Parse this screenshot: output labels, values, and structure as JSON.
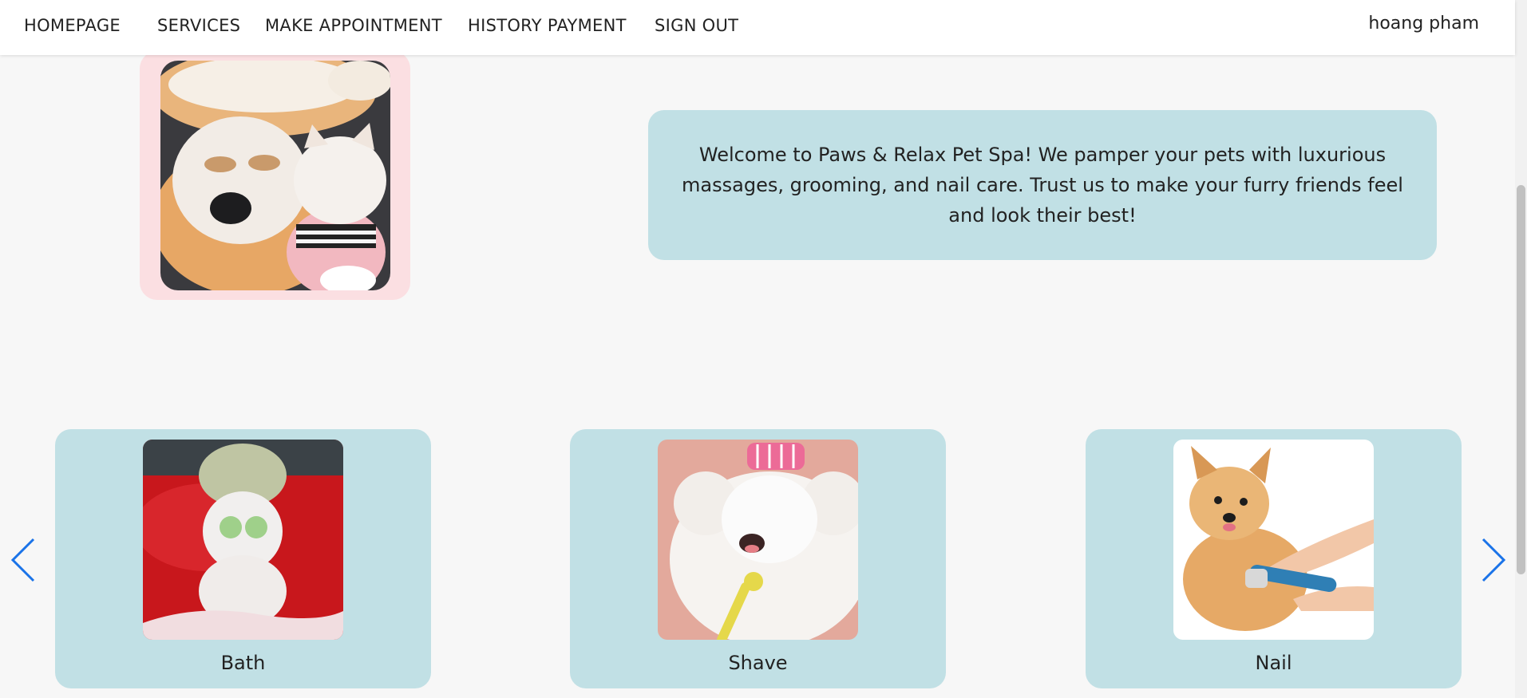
{
  "nav": {
    "items": [
      {
        "label": "HOMEPAGE"
      },
      {
        "label": "SERVICES"
      },
      {
        "label": "MAKE APPOINTMENT"
      },
      {
        "label": "HISTORY PAYMENT"
      },
      {
        "label": "SIGN OUT"
      }
    ],
    "user_name": "hoang pham"
  },
  "welcome": {
    "text": "Welcome to Paws & Relax Pet Spa! We pamper your pets with luxurious massages, grooming, and nail care. Trust us to make your furry friends feel and look their best!"
  },
  "services": [
    {
      "label": "Bath"
    },
    {
      "label": "Shave"
    },
    {
      "label": "Nail"
    }
  ],
  "colors": {
    "accent_blue": "#1a73e8",
    "card_bg": "#c1e0e5",
    "hero_frame": "#fbdfe2",
    "page_bg": "#f7f7f7"
  },
  "icons": {
    "prev": "chevron-left-icon",
    "next": "chevron-right-icon"
  }
}
